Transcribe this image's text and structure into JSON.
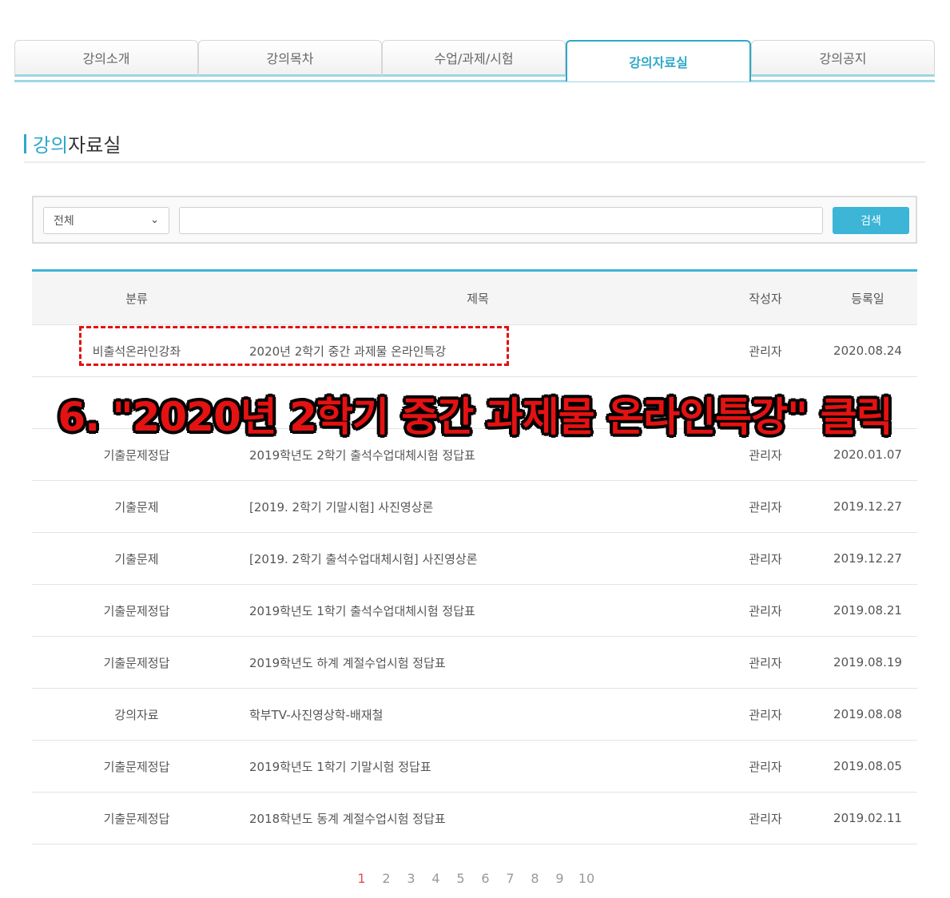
{
  "tabs": [
    {
      "label": "강의소개",
      "active": false
    },
    {
      "label": "강의목차",
      "active": false
    },
    {
      "label": "수업/과제/시험",
      "active": false
    },
    {
      "label": "강의자료실",
      "active": true
    },
    {
      "label": "강의공지",
      "active": false
    }
  ],
  "page_title": {
    "accent": "강의",
    "rest": "자료실"
  },
  "search": {
    "select_value": "전체",
    "input_value": "",
    "button_label": "검색"
  },
  "table": {
    "headers": {
      "category": "분류",
      "title": "제목",
      "author": "작성자",
      "date": "등록일"
    },
    "rows": [
      {
        "category": "비출석온라인강좌",
        "title": "2020년 2학기 중간 과제물 온라인특강",
        "author": "관리자",
        "date": "2020.08.24"
      },
      {
        "category": "",
        "title": "",
        "author": "",
        "date": ""
      },
      {
        "category": "기출문제정답",
        "title": "2019학년도 2학기 출석수업대체시험 정답표",
        "author": "관리자",
        "date": "2020.01.07"
      },
      {
        "category": "기출문제",
        "title": "[2019. 2학기 기말시험] 사진영상론",
        "author": "관리자",
        "date": "2019.12.27"
      },
      {
        "category": "기출문제",
        "title": "[2019. 2학기 출석수업대체시험] 사진영상론",
        "author": "관리자",
        "date": "2019.12.27"
      },
      {
        "category": "기출문제정답",
        "title": "2019학년도 1학기 출석수업대체시험 정답표",
        "author": "관리자",
        "date": "2019.08.21"
      },
      {
        "category": "기출문제정답",
        "title": "2019학년도 하계 계절수업시험 정답표",
        "author": "관리자",
        "date": "2019.08.19"
      },
      {
        "category": "강의자료",
        "title": "학부TV-사진영상학-배재철",
        "author": "관리자",
        "date": "2019.08.08"
      },
      {
        "category": "기출문제정답",
        "title": "2019학년도 1학기 기말시험 정답표",
        "author": "관리자",
        "date": "2019.08.05"
      },
      {
        "category": "기출문제정답",
        "title": "2018학년도 동계 계절수업시험 정답표",
        "author": "관리자",
        "date": "2019.02.11"
      }
    ]
  },
  "overlay_instruction": "6. \"2020년 2학기 중간 과제물 온라인특강\"  클릭",
  "pagination": [
    "1",
    "2",
    "3",
    "4",
    "5",
    "6",
    "7",
    "8",
    "9",
    "10"
  ],
  "colors": {
    "accent": "#2ea8c8",
    "highlight": "#e01010",
    "overlay_text": "#e41212"
  }
}
